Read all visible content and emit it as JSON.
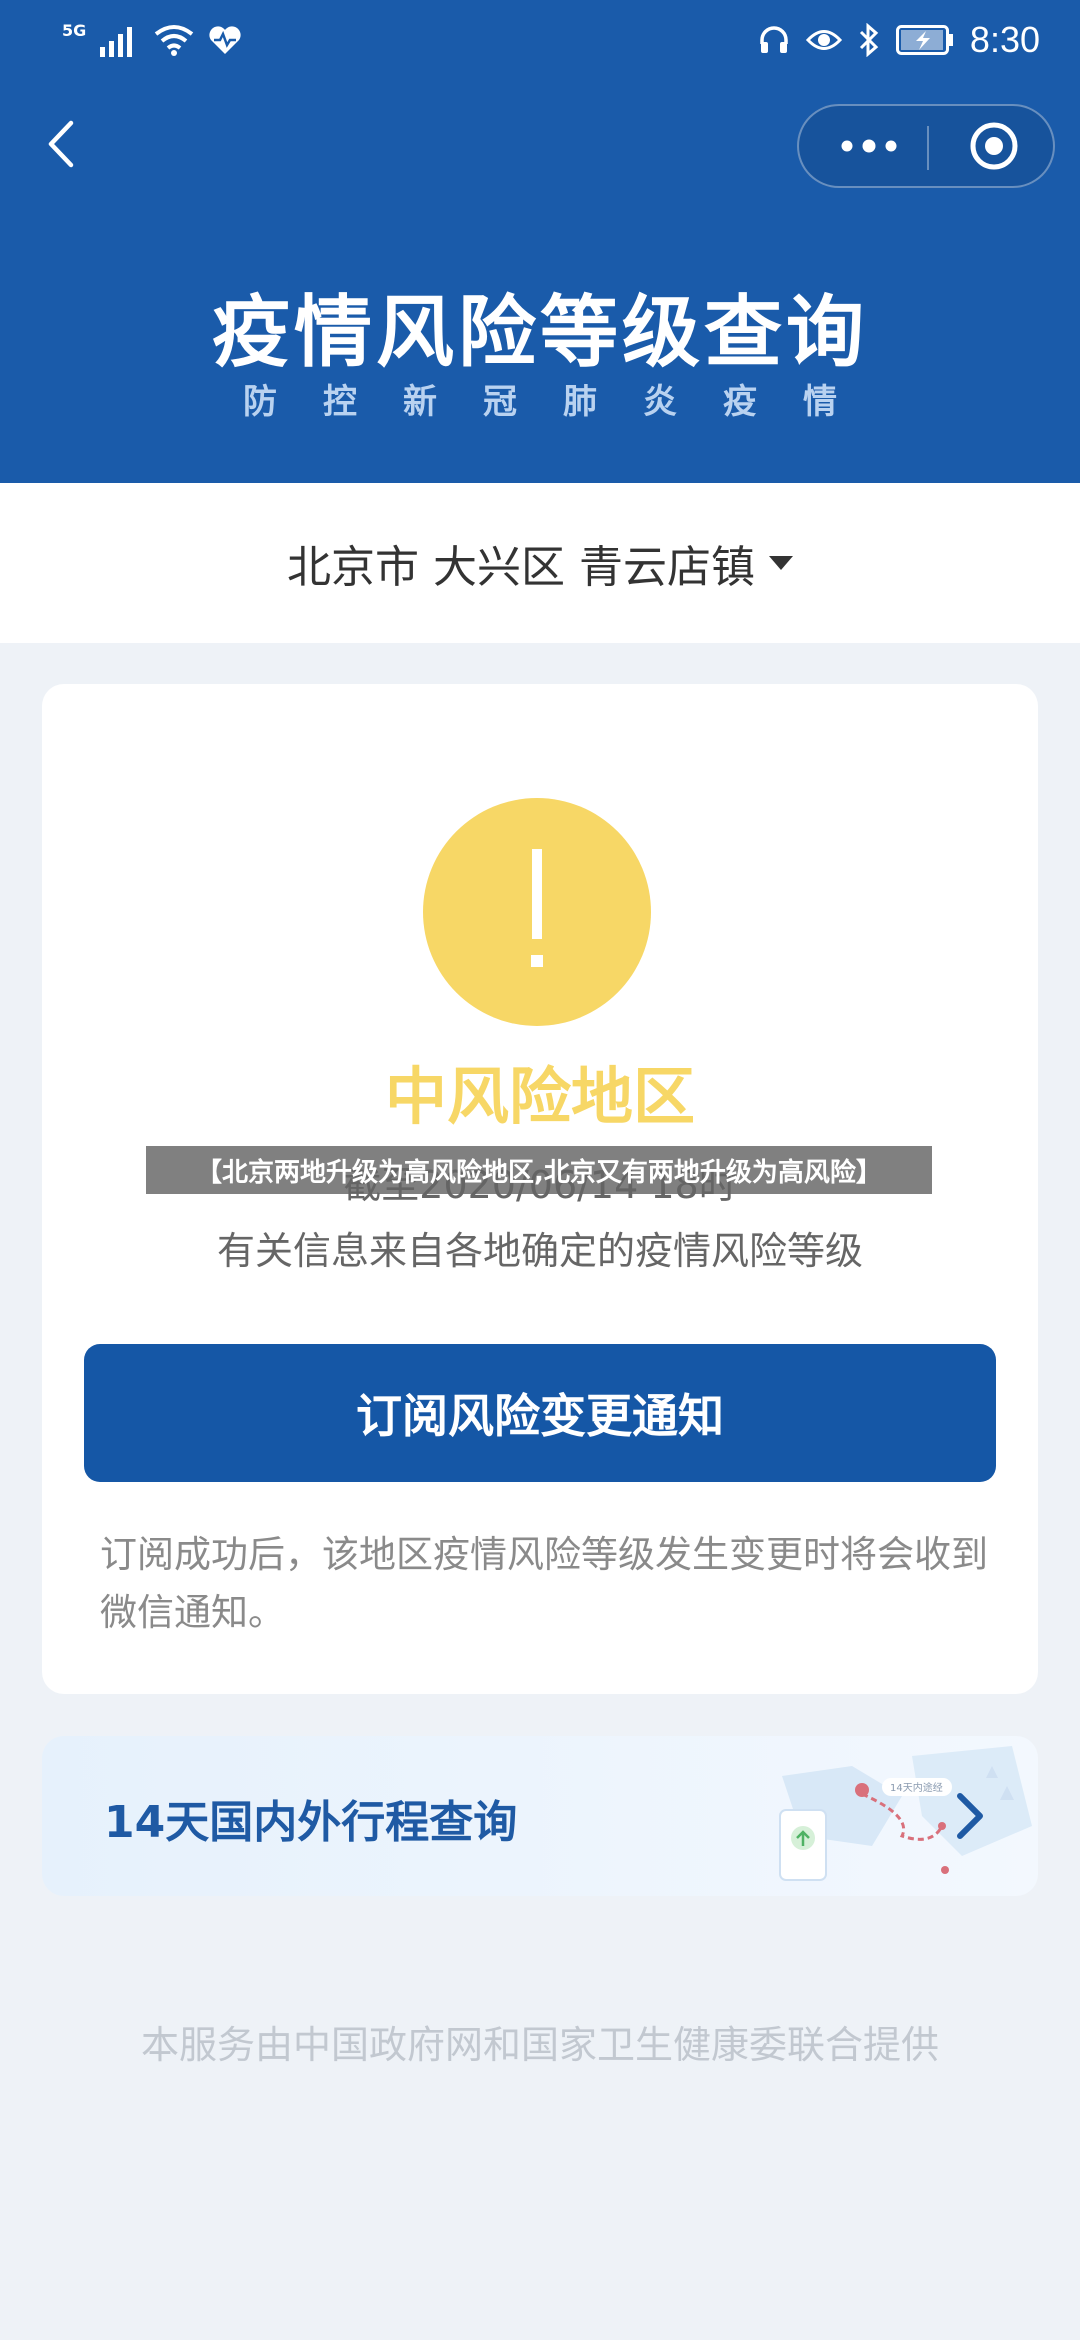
{
  "statusbar": {
    "network": "5G",
    "time": "8:30",
    "icons": [
      "signal-icon",
      "wifi-icon",
      "health-icon",
      "headphones-icon",
      "eye-icon",
      "bluetooth-icon",
      "battery-icon"
    ]
  },
  "header": {
    "title": "疫情风险等级查询",
    "subtitle_chars": [
      "防",
      "控",
      "新",
      "冠",
      "肺",
      "炎",
      "疫",
      "情"
    ],
    "background": "#1a5baa"
  },
  "location": {
    "text": "北京市 大兴区 青云店镇"
  },
  "risk_card": {
    "level": "中风险地区",
    "level_color": "#f7d766",
    "cutoff_text": "截至2020/06/14 18时",
    "info_source": "有关信息来自各地确定的疫情风险等级",
    "subscribe_label": "订阅风险变更通知",
    "subscribe_note": "订阅成功后，该地区疫情风险等级发生变更时将会收到微信通知。",
    "button_color": "#1557a6"
  },
  "trip_card": {
    "label": "14天国内外行程查询",
    "map_badge": "14天内途经"
  },
  "footer": {
    "provider": "本服务由中国政府网和国家卫生健康委联合提供"
  },
  "overlay": {
    "caption": "【北京两地升级为高风险地区,北京又有两地升级为高风险】"
  }
}
